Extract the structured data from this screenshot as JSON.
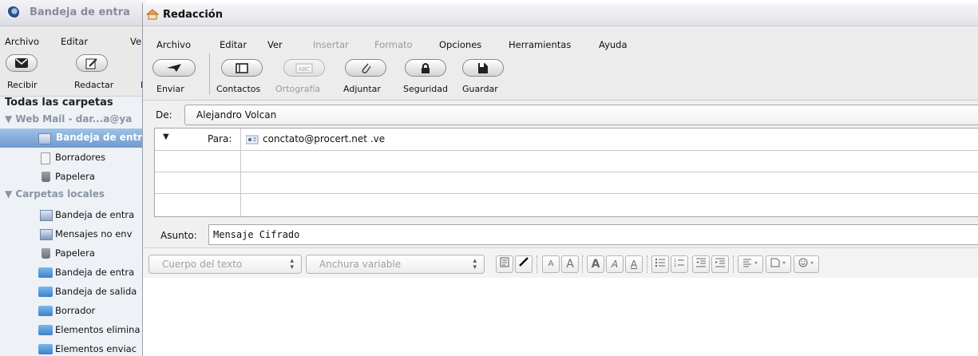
{
  "main_window": {
    "title": "Bandeja de entra",
    "menu": [
      "Archivo",
      "Editar",
      "Ve"
    ],
    "toolbar": [
      {
        "label": "Recibir",
        "icon": "envelope-icon"
      },
      {
        "label": "Redactar",
        "icon": "compose-icon"
      },
      {
        "label": "D",
        "icon": ""
      }
    ],
    "folders_header": "Todas las carpetas",
    "webmail_group": "Web Mail - dar...a@ya",
    "webmail_items": [
      {
        "label": "Bandeja de entr",
        "icon": "inbox-icon",
        "selected": true
      },
      {
        "label": "Borradores",
        "icon": "draft-icon",
        "selected": false
      },
      {
        "label": "Papelera",
        "icon": "trash-icon",
        "selected": false
      }
    ],
    "local_group": "Carpetas locales",
    "local_items": [
      {
        "label": "Bandeja de entra",
        "icon": "inbox-icon"
      },
      {
        "label": "Mensajes no env",
        "icon": "outbox-icon"
      },
      {
        "label": "Papelera",
        "icon": "trash-icon"
      },
      {
        "label": "Bandeja de entra",
        "icon": "folder-icon"
      },
      {
        "label": "Bandeja de salida",
        "icon": "folder-icon"
      },
      {
        "label": "Borrador",
        "icon": "folder-icon"
      },
      {
        "label": "Elementos elimina",
        "icon": "folder-icon"
      },
      {
        "label": "Elementos enviac",
        "icon": "folder-icon"
      }
    ]
  },
  "compose": {
    "title": "Redacción",
    "menu": [
      {
        "label": "Archivo",
        "enabled": true
      },
      {
        "label": "Editar",
        "enabled": true
      },
      {
        "label": "Ver",
        "enabled": true
      },
      {
        "label": "Insertar",
        "enabled": false
      },
      {
        "label": "Formato",
        "enabled": false
      },
      {
        "label": "Opciones",
        "enabled": true
      },
      {
        "label": "Herramientas",
        "enabled": true
      },
      {
        "label": "Ayuda",
        "enabled": true
      }
    ],
    "toolbar": [
      {
        "label": "Enviar",
        "icon": "send-icon",
        "enabled": true
      },
      {
        "label": "Contactos",
        "icon": "address-book-icon",
        "enabled": true
      },
      {
        "label": "Ortografía",
        "icon": "spellcheck-icon",
        "enabled": false
      },
      {
        "label": "Adjuntar",
        "icon": "paperclip-icon",
        "enabled": true
      },
      {
        "label": "Seguridad",
        "icon": "lock-icon",
        "enabled": true
      },
      {
        "label": "Guardar",
        "icon": "save-icon",
        "enabled": true
      }
    ],
    "from_label": "De:",
    "from_value": "Alejandro Volcan",
    "to_label": "Para:",
    "to_value": "conctato@procert.net .ve",
    "subject_label": "Asunto:",
    "subject_value": "Mensaje Cifrado",
    "format": {
      "paragraph_style": "Cuerpo del texto",
      "font": "Anchura variable",
      "buttons": [
        "A",
        "A",
        "A",
        "A",
        "A"
      ]
    }
  },
  "colors": {
    "selection": "#7fa6d6",
    "folder_bg": "#eef1f6",
    "toolbar_bg": "#ececec"
  }
}
